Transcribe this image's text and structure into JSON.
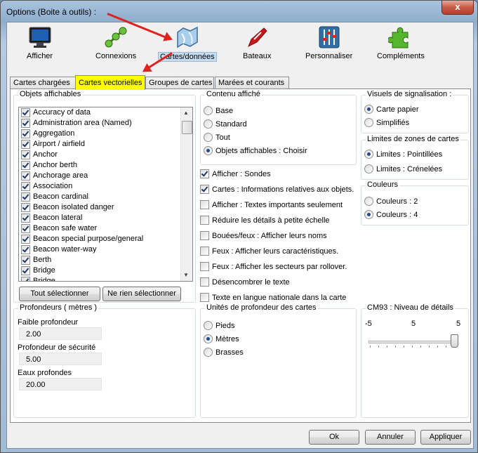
{
  "window": {
    "title": "Options (Boite à outils) :",
    "close": "x"
  },
  "toolbar": [
    {
      "label": "Afficher",
      "icon": "monitor-icon"
    },
    {
      "label": "Connexions",
      "icon": "connections-icon"
    },
    {
      "label": "Cartes/données",
      "icon": "chart-map-icon"
    },
    {
      "label": "Bateaux",
      "icon": "boat-icon"
    },
    {
      "label": "Personnaliser",
      "icon": "sliders-icon"
    },
    {
      "label": "Compléments",
      "icon": "puzzle-icon"
    }
  ],
  "tabs": [
    "Cartes chargées",
    "Cartes vectorielles",
    "Groupes de cartes",
    "Marées et courants"
  ],
  "objets": {
    "title": "Objets affichables",
    "items": [
      "Accuracy of data",
      "Administration area (Named)",
      "Aggregation",
      "Airport / airfield",
      "Anchor",
      "Anchor berth",
      "Anchorage area",
      "Association",
      "Beacon cardinal",
      "Beacon isolated danger",
      "Beacon lateral",
      "Beacon safe water",
      "Beacon special purpose/general",
      "Beacon water-way",
      "Berth",
      "Bridge",
      "Bridge"
    ],
    "select_all": "Tout sélectionner",
    "select_none": "Ne rien sélectionner"
  },
  "contenu": {
    "title": "Contenu affiché",
    "radios": [
      {
        "label": "Base",
        "checked": false
      },
      {
        "label": "Standard",
        "checked": false
      },
      {
        "label": "Tout",
        "checked": false
      },
      {
        "label": "Objets affichables : Choisir",
        "checked": true
      }
    ]
  },
  "options": [
    {
      "label": "Afficher : Sondes",
      "checked": true
    },
    {
      "label": "Cartes : Informations relatives aux objets.",
      "checked": true
    },
    {
      "label": "Afficher : Textes importants seulement",
      "checked": false
    },
    {
      "label": "Réduire les détails à petite échelle",
      "checked": false
    },
    {
      "label": "Bouées/feux : Afficher leurs noms",
      "checked": false
    },
    {
      "label": "Feux : Afficher leurs caractéristiques.",
      "checked": false
    },
    {
      "label": "Feux : Afficher les secteurs par rollover.",
      "checked": false
    },
    {
      "label": "Désencombrer le texte",
      "checked": false
    },
    {
      "label": "Texte en langue nationale dans la carte",
      "checked": false
    }
  ],
  "visuels": {
    "title": "Visuels de signalisation :",
    "radios": [
      {
        "label": "Carte papier",
        "checked": true
      },
      {
        "label": "Simplifiés",
        "checked": false
      }
    ]
  },
  "limites": {
    "title": "Limites de zones de cartes",
    "radios": [
      {
        "label": "Limites : Pointillées",
        "checked": true
      },
      {
        "label": "Limites : Crénelées",
        "checked": false
      }
    ]
  },
  "couleurs": {
    "title": "Couleurs",
    "radios": [
      {
        "label": "Couleurs : 2",
        "checked": false
      },
      {
        "label": "Couleurs : 4",
        "checked": true
      }
    ]
  },
  "profondeurs": {
    "title": "Profondeurs ( mètres )",
    "fields": [
      {
        "label": "Faible profondeur",
        "value": "2.00"
      },
      {
        "label": "Profondeur de sécurité",
        "value": "5.00"
      },
      {
        "label": "Eaux profondes",
        "value": "20.00"
      }
    ]
  },
  "unites": {
    "title": "Unités de profondeur des cartes",
    "radios": [
      {
        "label": "Pieds",
        "checked": false
      },
      {
        "label": "Mètres",
        "checked": true
      },
      {
        "label": "Brasses",
        "checked": false
      }
    ]
  },
  "cm93": {
    "title": "CM93 : Niveau de détails",
    "min": "-5",
    "mid": "5",
    "max": "5",
    "value_fraction": 1.0
  },
  "footer": {
    "ok": "Ok",
    "cancel": "Annuler",
    "apply": "Appliquer"
  },
  "colors": {
    "annotation_arrow": "#e0211d",
    "tab_highlight": "#ffff00"
  }
}
